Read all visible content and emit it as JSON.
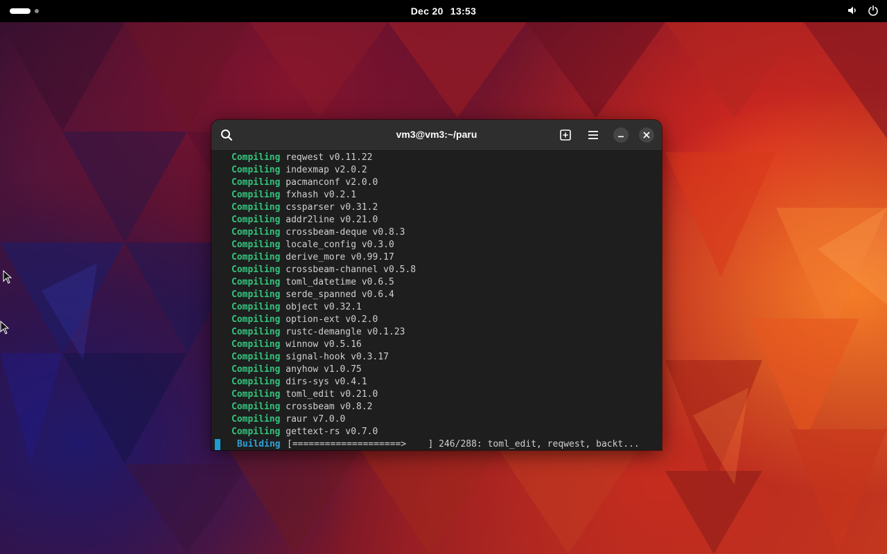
{
  "topbar": {
    "date": "Dec 20",
    "time": "13:53",
    "activities_icon": "workspace-indicator-icon",
    "volume_icon": "volume-icon",
    "power_icon": "power-icon"
  },
  "terminal": {
    "title": "vm3@vm3:~/paru",
    "search_icon": "search-icon",
    "new_tab_icon": "new-tab-icon",
    "menu_icon": "hamburger-menu-icon",
    "minimize_icon": "minimize-icon",
    "close_icon": "close-icon",
    "lines": [
      {
        "keyword": "Compiling",
        "text": "reqwest v0.11.22"
      },
      {
        "keyword": "Compiling",
        "text": "indexmap v2.0.2"
      },
      {
        "keyword": "Compiling",
        "text": "pacmanconf v2.0.0"
      },
      {
        "keyword": "Compiling",
        "text": "fxhash v0.2.1"
      },
      {
        "keyword": "Compiling",
        "text": "cssparser v0.31.2"
      },
      {
        "keyword": "Compiling",
        "text": "addr2line v0.21.0"
      },
      {
        "keyword": "Compiling",
        "text": "crossbeam-deque v0.8.3"
      },
      {
        "keyword": "Compiling",
        "text": "locale_config v0.3.0"
      },
      {
        "keyword": "Compiling",
        "text": "derive_more v0.99.17"
      },
      {
        "keyword": "Compiling",
        "text": "crossbeam-channel v0.5.8"
      },
      {
        "keyword": "Compiling",
        "text": "toml_datetime v0.6.5"
      },
      {
        "keyword": "Compiling",
        "text": "serde_spanned v0.6.4"
      },
      {
        "keyword": "Compiling",
        "text": "object v0.32.1"
      },
      {
        "keyword": "Compiling",
        "text": "option-ext v0.2.0"
      },
      {
        "keyword": "Compiling",
        "text": "rustc-demangle v0.1.23"
      },
      {
        "keyword": "Compiling",
        "text": "winnow v0.5.16"
      },
      {
        "keyword": "Compiling",
        "text": "signal-hook v0.3.17"
      },
      {
        "keyword": "Compiling",
        "text": "anyhow v1.0.75"
      },
      {
        "keyword": "Compiling",
        "text": "dirs-sys v0.4.1"
      },
      {
        "keyword": "Compiling",
        "text": "toml_edit v0.21.0"
      },
      {
        "keyword": "Compiling",
        "text": "crossbeam v0.8.2"
      },
      {
        "keyword": "Compiling",
        "text": "raur v7.0.0"
      },
      {
        "keyword": "Compiling",
        "text": "gettext-rs v0.7.0"
      }
    ],
    "build": {
      "keyword": "Building",
      "progress": "[====================>    ] 246/288: toml_edit, reqwest, backt..."
    },
    "colors": {
      "compiling": "#33c47d",
      "building": "#2fa3d8",
      "cursor": "#1c9fd4",
      "background": "#1e1e1e",
      "headerbar": "#2e2e2e"
    }
  }
}
